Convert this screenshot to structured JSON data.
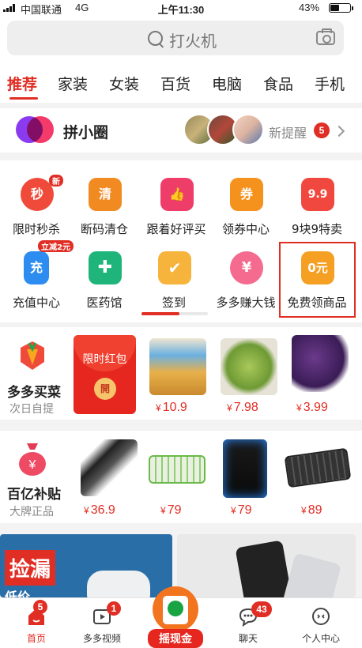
{
  "status_bar": {
    "carrier": "中国联通",
    "network": "4G",
    "time": "上午11:30",
    "battery": "43%"
  },
  "search": {
    "placeholder": "打火机",
    "icon": "search-icon",
    "camera_icon": "camera-icon"
  },
  "tabs": [
    "推荐",
    "家装",
    "女装",
    "百货",
    "电脑",
    "食品",
    "手机"
  ],
  "active_tab": "推荐",
  "pin_circle": {
    "title": "拼小圈",
    "remind_label": "新提醒",
    "remind_count": "5"
  },
  "grid": {
    "row1": [
      {
        "label": "限时秒杀",
        "icon_text": "秒",
        "tag": "新",
        "color": "#f04b3a"
      },
      {
        "label": "断码清仓",
        "icon_text": "清",
        "color": "#f28a22"
      },
      {
        "label": "跟着好评买",
        "icon_text": "👍",
        "color": "#ef3d69"
      },
      {
        "label": "领券中心",
        "icon_text": "券",
        "color": "#f5921e"
      },
      {
        "label": "9块9特卖",
        "icon_text": "9.9",
        "color": "#f0483e"
      }
    ],
    "row2": [
      {
        "label": "充值中心",
        "icon_text": "充",
        "tag": "立减2元",
        "color": "#2d8cf0"
      },
      {
        "label": "医药馆",
        "icon_text": "✚",
        "color": "#1fb57a"
      },
      {
        "label": "签到",
        "icon_text": "✔",
        "color": "#f6b43c"
      },
      {
        "label": "多多赚大钱",
        "icon_text": "¥",
        "color": "#f46b8f"
      },
      {
        "label": "免费领商品",
        "icon_text": "0元",
        "color": "#f5a023"
      }
    ]
  },
  "grocery": {
    "title": "多多买菜",
    "subtitle": "次日自提",
    "redpack_text": "限时红包",
    "redpack_coin": "開",
    "products": [
      {
        "price": "10.9",
        "name": "snack-product"
      },
      {
        "price": "7.98",
        "name": "vegetable-product"
      },
      {
        "price": "3.99",
        "name": "grape-product"
      }
    ]
  },
  "subsidy": {
    "title": "百亿补贴",
    "subtitle": "大牌正品",
    "products": [
      {
        "price": "36.9",
        "name": "saw-product"
      },
      {
        "price": "79",
        "name": "keyboard-product"
      },
      {
        "price": "79",
        "name": "pc-case-product"
      },
      {
        "price": "89",
        "name": "mech-keyboard-product"
      }
    ]
  },
  "currency": "¥",
  "banners": {
    "left_tag": "捡漏",
    "left_sub": "低价..."
  },
  "tabbar": [
    {
      "label": "首页",
      "badge": "5",
      "active": true
    },
    {
      "label": "多多视频",
      "badge": "1",
      "active": false
    },
    {
      "label": "摇现金",
      "badge": "",
      "active": false
    },
    {
      "label": "聊天",
      "badge": "43",
      "active": false
    },
    {
      "label": "个人中心",
      "badge": "",
      "active": false
    }
  ],
  "colors": {
    "accent": "#e02e24",
    "orange": "#f3741f"
  }
}
